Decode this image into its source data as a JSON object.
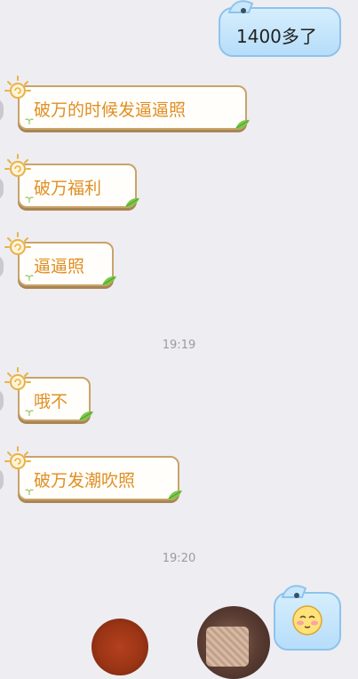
{
  "messages": [
    {
      "side": "out",
      "text": "1400多了"
    },
    {
      "side": "in",
      "text": "破万的时候发逼逼照"
    },
    {
      "side": "in",
      "text": "破万福利"
    },
    {
      "side": "in",
      "text": "逼逼照"
    },
    {
      "side": "time",
      "text": "19:19"
    },
    {
      "side": "in",
      "text": "哦不"
    },
    {
      "side": "in",
      "text": "破万发潮吹照"
    },
    {
      "side": "time",
      "text": "19:20"
    },
    {
      "side": "out",
      "emoji": "blush-emoji"
    }
  ],
  "colors": {
    "incoming_text": "#e08f24",
    "incoming_border": "#c9a36a",
    "outgoing_bubble": "#c6e6fb",
    "timestamp": "#9b9ba3",
    "background": "#eeedf2"
  }
}
